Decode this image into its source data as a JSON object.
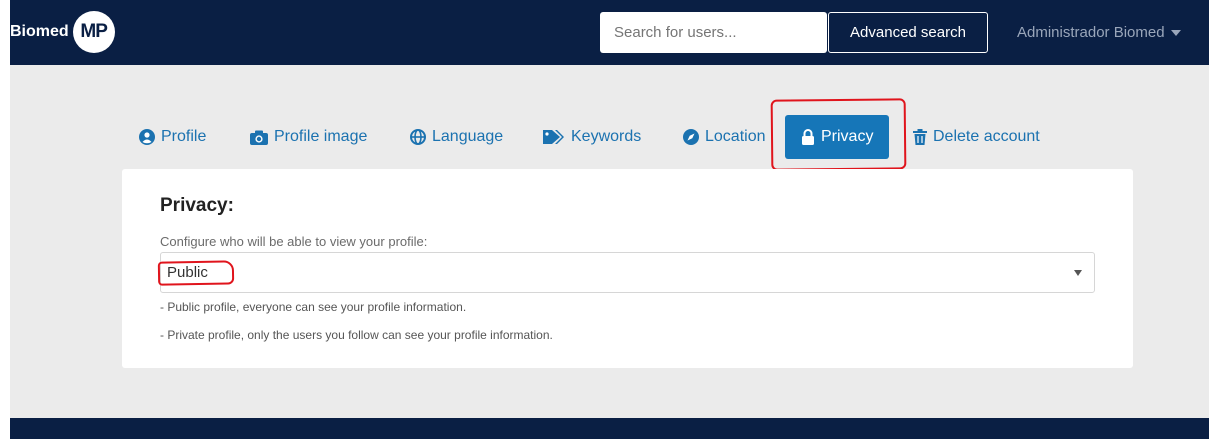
{
  "navbar": {
    "brand_text": "Biomed",
    "brand_logo": "MP",
    "search_placeholder": "Search for users...",
    "advanced_search": "Advanced search",
    "user_name": "Administrador Biomed"
  },
  "tabs": [
    {
      "label": "Profile",
      "icon": "user-circle-icon"
    },
    {
      "label": "Profile image",
      "icon": "camera-icon"
    },
    {
      "label": "Language",
      "icon": "globe-icon"
    },
    {
      "label": "Keywords",
      "icon": "tags-icon"
    },
    {
      "label": "Location",
      "icon": "compass-icon"
    },
    {
      "label": "Privacy",
      "icon": "lock-icon",
      "active": true
    },
    {
      "label": "Delete account",
      "icon": "trash-icon"
    }
  ],
  "privacy": {
    "title": "Privacy:",
    "description": "Configure who will be able to view your profile:",
    "selected": "Public",
    "notes": [
      "- Public profile, everyone can see your profile information.",
      "- Private profile, only the users you follow can see your profile information."
    ]
  },
  "colors": {
    "navbar": "#0a1f44",
    "accent": "#1676b8",
    "annotation": "#e0141c",
    "background": "#ebebeb"
  }
}
